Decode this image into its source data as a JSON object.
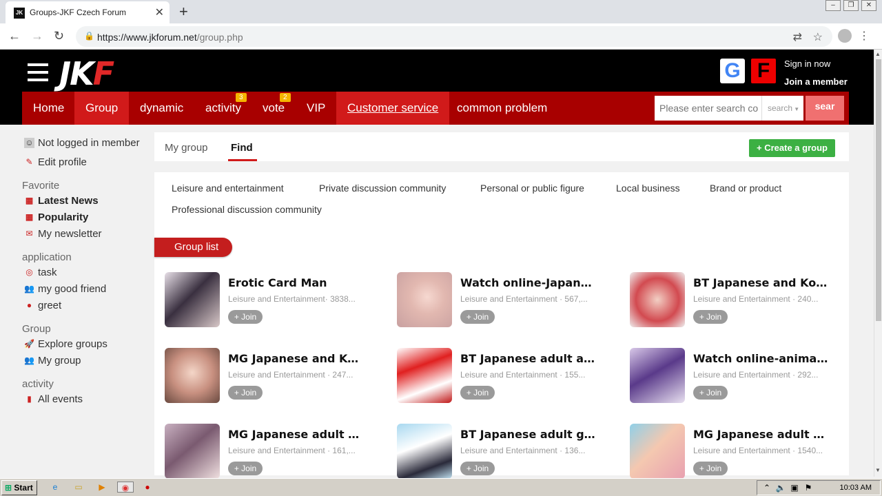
{
  "browser": {
    "tab_title": "Groups-JKF Czech Forum",
    "url_main": "https://www.jkforum.net",
    "url_path": "/group.php"
  },
  "header": {
    "logo_main": "JK",
    "logo_accent": "F",
    "google_letter": "G",
    "fb_letter": "F",
    "sign_in": "Sign in now",
    "join_member": "Join a member"
  },
  "nav": {
    "items": [
      {
        "label": "Home"
      },
      {
        "label": "Group"
      },
      {
        "label": "dynamic"
      },
      {
        "label": "activity",
        "badge": "3"
      },
      {
        "label": "vote",
        "badge": "2"
      },
      {
        "label": "VIP"
      },
      {
        "label": "Customer service"
      },
      {
        "label": "common problem"
      }
    ],
    "search_placeholder": "Please enter search co",
    "search_select": "search",
    "search_button": "sear"
  },
  "sidebar": {
    "user": "Not logged in member",
    "edit_profile": "Edit profile",
    "favorite_head": "Favorite",
    "latest_news": "Latest News",
    "popularity": "Popularity",
    "newsletter": "My newsletter",
    "application_head": "application",
    "task": "task",
    "friend": "my good friend",
    "greet": "greet",
    "group_head": "Group",
    "explore": "Explore groups",
    "my_group": "My group",
    "activity_head": "activity",
    "all_events": "All events"
  },
  "main": {
    "tab_my_group": "My group",
    "tab_find": "Find",
    "create_group": "+ Create a group",
    "categories": [
      "Leisure and entertainment",
      "Private discussion community",
      "Personal or public figure",
      "Local business",
      "Brand or product",
      "Professional discussion community"
    ],
    "group_list_label": "Group list",
    "join_label": "+ Join",
    "groups": [
      {
        "title": "Erotic Card Man",
        "meta": "Leisure and Entertainment· 3838..."
      },
      {
        "title": "Watch online-Japanese",
        "meta": "Leisure and Entertainment · 567,..."
      },
      {
        "title": "BT Japanese and Korean",
        "meta": "Leisure and Entertainment · 240..."
      },
      {
        "title": "MG Japanese and Korean",
        "meta": "Leisure and Entertainment · 247..."
      },
      {
        "title": "BT Japanese adult anime",
        "meta": "Leisure and Entertainment · 155..."
      },
      {
        "title": "Watch online-animation",
        "meta": "Leisure and Entertainment · 292..."
      },
      {
        "title": "MG Japanese adult games",
        "meta": "Leisure and Entertainment · 161,..."
      },
      {
        "title": "BT Japanese adult games",
        "meta": "Leisure and Entertainment · 136..."
      },
      {
        "title": "MG Japanese adult anime",
        "meta": "Leisure and Entertainment · 1540..."
      }
    ]
  },
  "taskbar": {
    "start": "Start",
    "clock": "10:03 AM"
  }
}
